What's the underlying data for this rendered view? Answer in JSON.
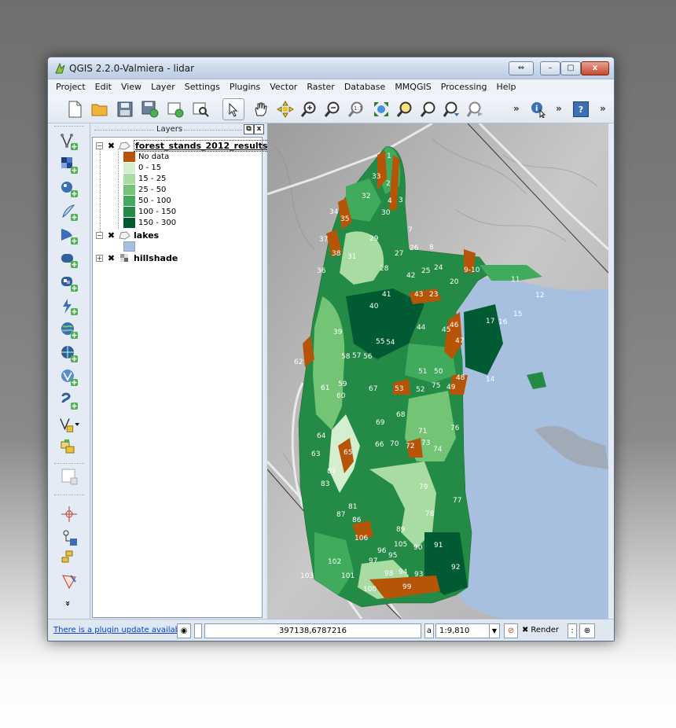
{
  "window": {
    "title": "QGIS 2.2.0-Valmiera - lidar",
    "controls": [
      "⇔",
      "–",
      "▢",
      "x"
    ]
  },
  "menu": [
    "Project",
    "Edit",
    "View",
    "Layer",
    "Settings",
    "Plugins",
    "Vector",
    "Raster",
    "Database",
    "MMQGIS",
    "Processing",
    "Help"
  ],
  "toolbar": {
    "overflow_1": "»",
    "overflow_2": "»",
    "overflow_3": "»",
    "help": "?"
  },
  "left_toolbar": {
    "more": "»"
  },
  "layers_panel": {
    "title": "Layers",
    "float_label": "⧉",
    "close_label": "x",
    "layers": [
      {
        "name": "forest_stands_2012_results",
        "expanded": true,
        "legend": [
          {
            "label": "No data",
            "color": "#b65407"
          },
          {
            "label": "0 - 15",
            "color": "#d4efcf"
          },
          {
            "label": "15 - 25",
            "color": "#a8dca2"
          },
          {
            "label": "25 - 50",
            "color": "#74c476"
          },
          {
            "label": "50 - 100",
            "color": "#41ab5d"
          },
          {
            "label": "100 - 150",
            "color": "#238b45"
          },
          {
            "label": "150 - 300",
            "color": "#005a32"
          }
        ]
      },
      {
        "name": "lakes",
        "expanded": true,
        "color": "#a8c0e0"
      },
      {
        "name": "hillshade",
        "expanded": false
      }
    ]
  },
  "map": {
    "colors": {
      "lake": "#a8c0e0",
      "nodata": "#b65407"
    },
    "stand_labels": [
      "1",
      "2",
      "3",
      "4",
      "7",
      "8",
      "9-10",
      "11",
      "12",
      "14",
      "15",
      "16",
      "17",
      "20",
      "23",
      "24",
      "25",
      "26",
      "27",
      "28",
      "29",
      "30",
      "31",
      "32",
      "33",
      "34",
      "35",
      "36",
      "37",
      "38",
      "39",
      "40",
      "41",
      "42",
      "43",
      "44",
      "45",
      "46",
      "47",
      "48",
      "49",
      "50",
      "51",
      "52",
      "53",
      "54",
      "55",
      "56",
      "57",
      "58",
      "59",
      "60",
      "61",
      "62",
      "63",
      "64",
      "65",
      "66",
      "67",
      "68",
      "69",
      "70",
      "71",
      "72",
      "73",
      "74",
      "75",
      "76",
      "77",
      "78",
      "79",
      "81",
      "82",
      "83",
      "86",
      "87",
      "89",
      "90",
      "91",
      "92",
      "93",
      "94",
      "95",
      "96",
      "97",
      "98",
      "99",
      "100",
      "101",
      "102",
      "103",
      "105",
      "106"
    ]
  },
  "status": {
    "plugin_update": "There is a plugin update available",
    "coordinate": "397138,6787216",
    "scale_label": "a",
    "scale": "1:9,810",
    "render_label": "Render"
  }
}
